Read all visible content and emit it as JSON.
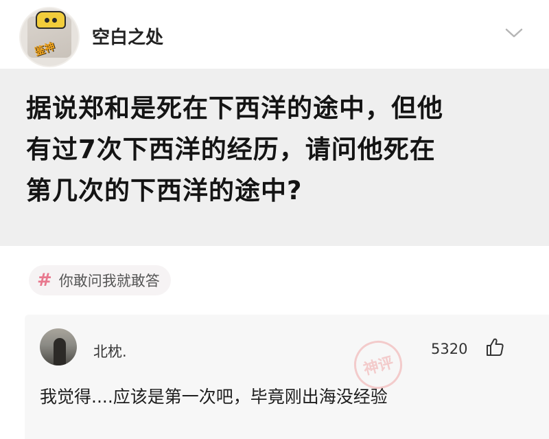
{
  "header": {
    "username": "空白之处",
    "avatar_badge": "鉴神"
  },
  "question": {
    "lines": [
      "据说郑和是死在下西洋的途中，但他",
      "有过7次下西洋的经历，请问他死在",
      "第几次的下西洋的途中?"
    ]
  },
  "topic": {
    "label": "你敢问我就敢答"
  },
  "comment": {
    "author": "北枕.",
    "likes": "5320",
    "text": "我觉得....应该是第一次吧，毕竟刚出海没经验",
    "watermark": "神评"
  },
  "colors": {
    "question_bg": "#efefef",
    "topic_icon": "#e8788e",
    "comment_bg": "#f7f7f7"
  }
}
